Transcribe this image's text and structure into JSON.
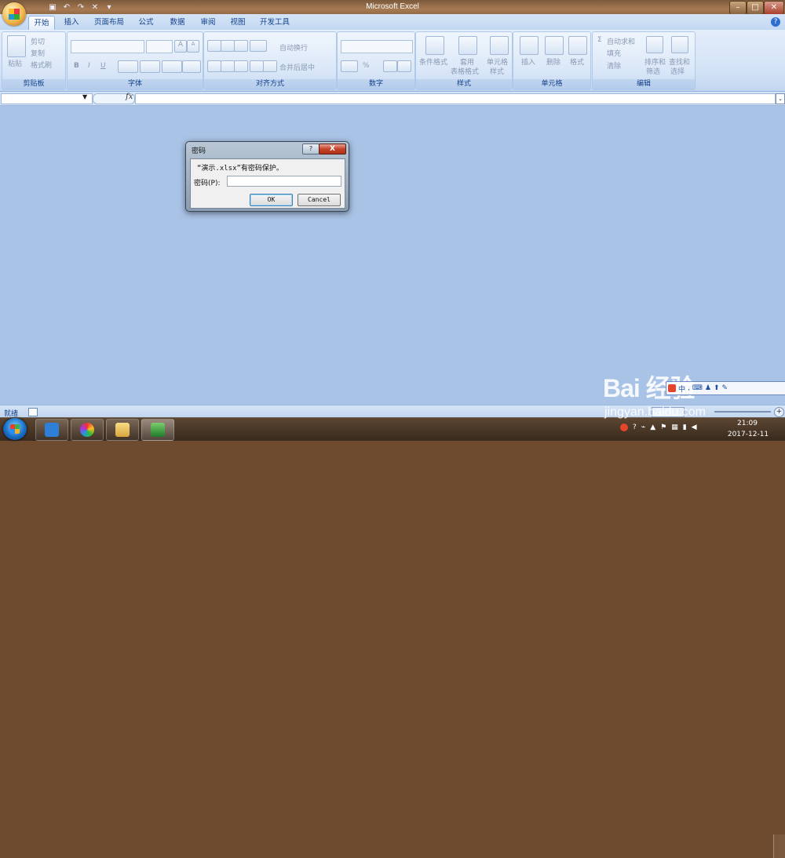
{
  "window": {
    "title": "Microsoft Excel"
  },
  "tabs": [
    "开始",
    "插入",
    "页面布局",
    "公式",
    "数据",
    "审阅",
    "视图",
    "开发工具"
  ],
  "ribbon": {
    "clipboard": {
      "group": "剪贴板",
      "paste": "粘贴",
      "cut": "剪切",
      "copy": "复制",
      "format_painter": "格式刷"
    },
    "font": {
      "group": "字体",
      "bold": "B",
      "italic": "I",
      "underline": "U",
      "grow": "A",
      "shrink": "A"
    },
    "alignment": {
      "group": "对齐方式",
      "wrap": "自动换行",
      "merge": "合并后居中"
    },
    "number": {
      "group": "数字",
      "percent": "%"
    },
    "styles": {
      "group": "样式",
      "conditional": "条件格式",
      "as_table_1": "套用",
      "as_table_2": "表格格式",
      "cell_style_1": "单元格",
      "cell_style_2": "样式"
    },
    "cells": {
      "group": "单元格",
      "insert": "插入",
      "delete": "删除",
      "format": "格式"
    },
    "editing": {
      "group": "编辑",
      "autosum": "自动求和",
      "fill": "填充",
      "clear": "清除",
      "sort_1": "排序和",
      "sort_2": "筛选",
      "find_1": "查找和",
      "find_2": "选择"
    }
  },
  "formula_bar": {
    "fx": "fx"
  },
  "dialog": {
    "title": "密码",
    "help": "?",
    "close": "X",
    "message": "“演示.xlsx”有密码保护。",
    "label": "密码(P):",
    "ok": "OK",
    "cancel": "Cancel"
  },
  "status": {
    "text": "就绪"
  },
  "clock": {
    "time": "21:09",
    "date": "2017-12-11"
  },
  "watermark": {
    "brand": "Bai 经验",
    "url": "jingyan.baidu.com",
    "ime": "中"
  },
  "colors": {
    "ribbon": "#d2e2f6",
    "workspace": "#a9c3e6",
    "close_button": "#c5422a"
  }
}
